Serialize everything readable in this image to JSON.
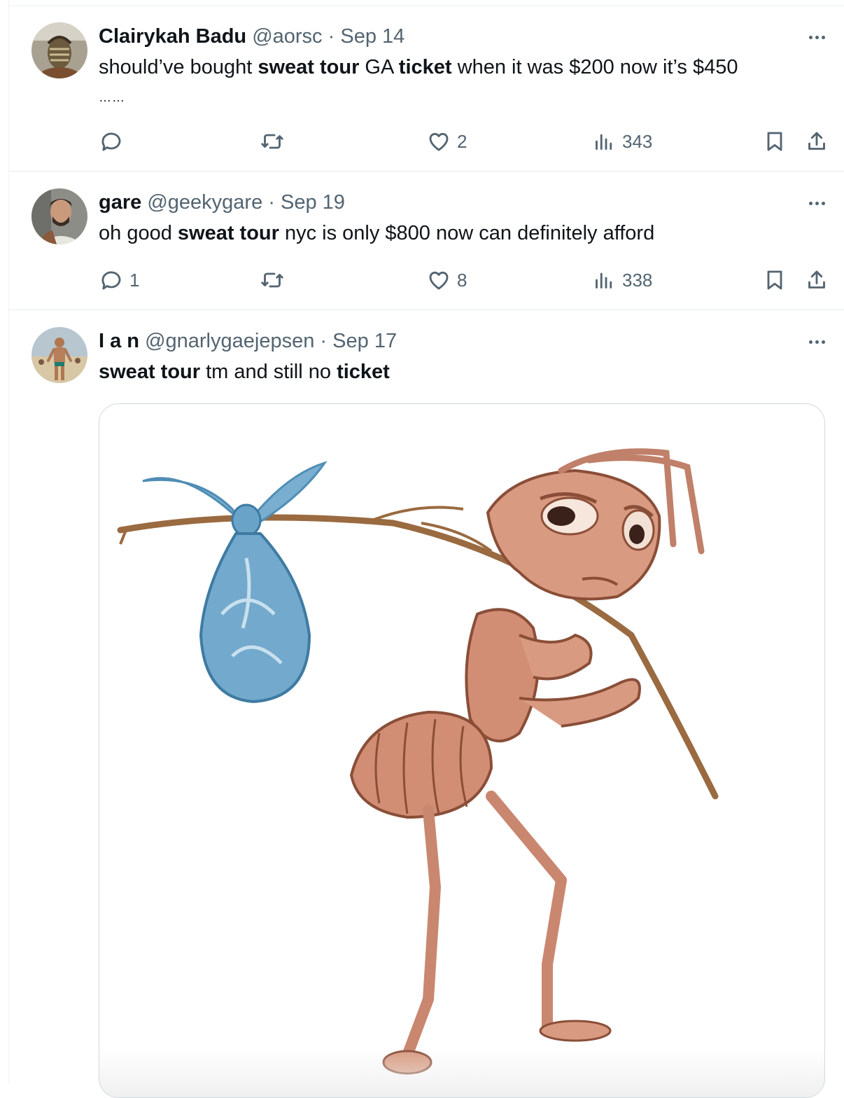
{
  "tweets": [
    {
      "name": "Clairykah Badu",
      "handle": "@aorsc",
      "sep": "·",
      "date": "Sep 14",
      "text": {
        "p1": "should’ve bought ",
        "b1": "sweat tour",
        "p2": " GA ",
        "b2": "ticket",
        "p3": " when it was $200 now it’s $450",
        "p4": "……"
      },
      "replies": "",
      "likes": "2",
      "views": "343"
    },
    {
      "name": "gare",
      "handle": "@geekygare",
      "sep": "·",
      "date": "Sep 19",
      "text": {
        "p1": "oh good ",
        "b1": "sweat tour",
        "p2": " nyc is only $800 now can definitely afford"
      },
      "replies": "1",
      "likes": "8",
      "views": "338"
    },
    {
      "name": "I a n",
      "handle": "@gnarlygaejepsen",
      "sep": "·",
      "date": "Sep 17",
      "text": {
        "b1": "sweat tour",
        "p1": " tm and still no ",
        "b2": "ticket"
      }
    }
  ],
  "icons": {
    "reply": "reply-icon",
    "retweet": "retweet-icon",
    "like": "heart-icon",
    "views": "views-icon",
    "bookmark": "bookmark-icon",
    "share": "share-icon",
    "more": "more-icon"
  },
  "colors": {
    "text": "#0f1419",
    "secondary": "#536471",
    "border": "#cfd9de"
  }
}
